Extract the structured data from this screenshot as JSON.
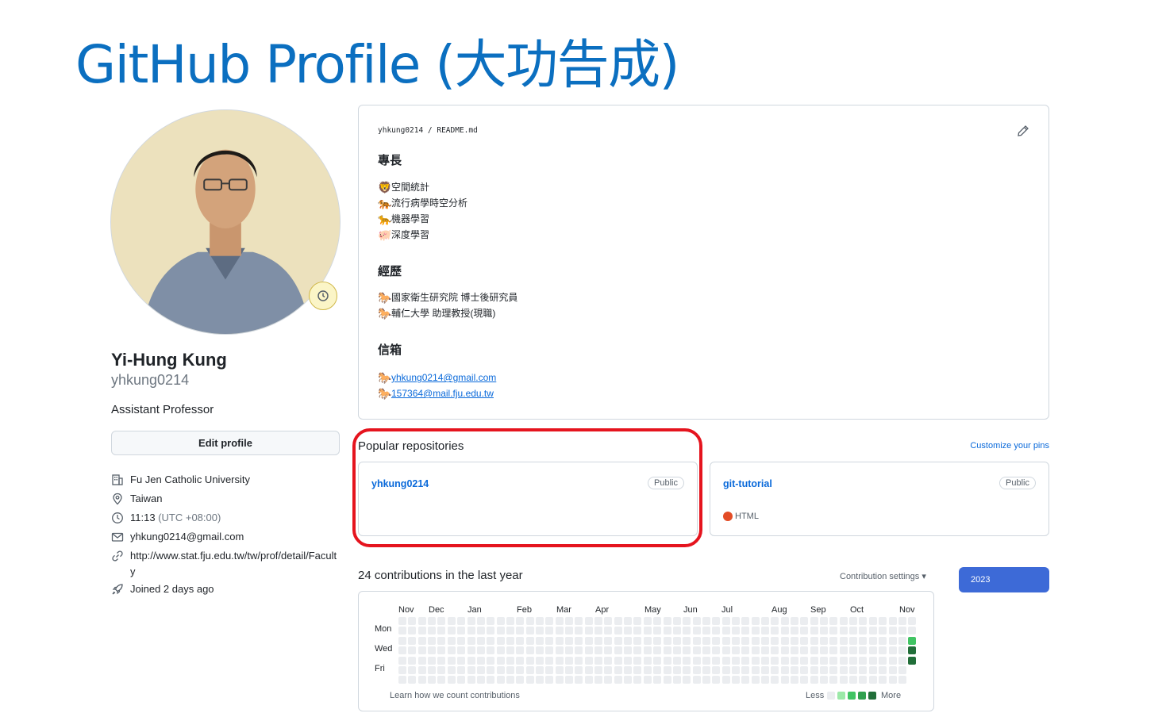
{
  "slide": {
    "title": "GitHub Profile (大功告成)"
  },
  "profile": {
    "full_name": "Yi-Hung Kung",
    "username": "yhkung0214",
    "bio": "Assistant Professor",
    "edit_label": "Edit profile",
    "organization": "Fu Jen Catholic University",
    "location": "Taiwan",
    "local_time": "11:13",
    "timezone": "(UTC +08:00)",
    "email": "yhkung0214@gmail.com",
    "website": "http://www.stat.fju.edu.tw/tw/prof/detail/Faculty",
    "joined": "Joined 2 days ago"
  },
  "readme": {
    "path": "yhkung0214 / README.md",
    "sections": [
      {
        "heading": "專長",
        "items": [
          {
            "emoji": "🦁",
            "text": "空間統計"
          },
          {
            "emoji": "🐅",
            "text": "流行病學時空分析"
          },
          {
            "emoji": "🐆",
            "text": "機器學習"
          },
          {
            "emoji": "🐖",
            "text": "深度學習"
          }
        ]
      },
      {
        "heading": "經歷",
        "items": [
          {
            "emoji": "🐎",
            "text": "國家衛生研究院 博士後研究員"
          },
          {
            "emoji": "🐎",
            "text": "輔仁大學 助理教授(現職)"
          }
        ]
      },
      {
        "heading": "信箱",
        "items": [
          {
            "emoji": "🐎",
            "text": "yhkung0214@gmail.com"
          },
          {
            "emoji": "🐎",
            "text": "157364@mail.fju.edu.tw"
          }
        ]
      }
    ]
  },
  "popular": {
    "title": "Popular repositories",
    "customize_label": "Customize your pins",
    "repos": [
      {
        "name": "yhkung0214",
        "visibility": "Public",
        "language": ""
      },
      {
        "name": "git-tutorial",
        "visibility": "Public",
        "language": "HTML",
        "language_color": "#e34c26"
      }
    ]
  },
  "contributions": {
    "title": "24 contributions in the last year",
    "settings_label": "Contribution settings ▾",
    "year": "2023",
    "months": [
      "Nov",
      "Dec",
      "Jan",
      "Feb",
      "Mar",
      "Apr",
      "May",
      "Jun",
      "Jul",
      "Aug",
      "Sep",
      "Oct",
      "Nov"
    ],
    "day_labels": [
      "Mon",
      "Wed",
      "Fri"
    ],
    "learn_label": "Learn how we count contributions",
    "legend_less": "Less",
    "legend_more": "More",
    "legend_colors": [
      "#ebedf0",
      "#9be9a8",
      "#40c463",
      "#30a14e",
      "#216e39"
    ],
    "active_days": [
      {
        "week": 52,
        "weekday": 2,
        "level": 2
      },
      {
        "week": 52,
        "weekday": 3,
        "level": 4
      },
      {
        "week": 52,
        "weekday": 4,
        "level": 4
      }
    ]
  },
  "colors": {
    "link": "#0969da",
    "highlight": "#e5141e",
    "title": "#0b6fc0",
    "year_button": "#3d6ad7"
  }
}
